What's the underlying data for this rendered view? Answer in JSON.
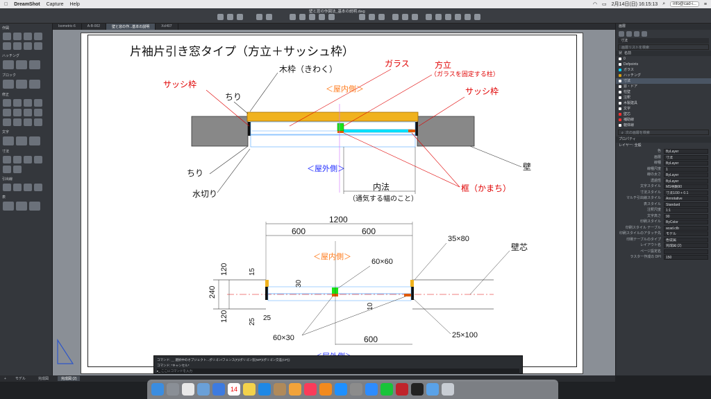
{
  "menubar": {
    "apple": "",
    "app_name": "DreamShot",
    "items": [
      "Capture",
      "Help"
    ],
    "clock": "2月14日(日)  16:15:13",
    "account": "info@cad-i..."
  },
  "window": {
    "title": "壁と窓の作図法_基本の説明.dwg"
  },
  "tabs": [
    "Isometric-6",
    "A-B-002",
    "壁と窓の作...基本の説明",
    "Xcl407"
  ],
  "left_palette": {
    "title": "作図",
    "sections": [
      "ハッチング",
      "ブロック",
      "修正",
      "文字",
      "寸法",
      "引出線",
      "表"
    ]
  },
  "drawing": {
    "title": "片袖片引き窓タイプ（方立＋サッシュ枠）",
    "top": {
      "mokuwaku": "木枠（きわく）",
      "chiri_top": "ちり",
      "sash_waku": "サッシ枠",
      "glass": "ガラス",
      "houdate": "方立",
      "houdate_note": "（ガラスを固定する柱）",
      "sash_waku_right": "サッシ枠",
      "indoor": "＜屋内側＞",
      "outdoor": "＜屋外側＞",
      "chiri_bottom": "ちり",
      "mizukiri": "水切り",
      "kabe": "壁",
      "uchinori": "内法",
      "uchinori_note": "（通気する幅のこと）",
      "kamachi": "框（かまち）"
    },
    "bottom": {
      "dim_1200": "1200",
      "dim_600_left": "600",
      "dim_600_right": "600",
      "indoor": "＜屋内側＞",
      "outdoor": "＜屋外側＞",
      "dim_35x80": "35×80",
      "kabeshin": "壁芯",
      "dim_60x60": "60×60",
      "dim_120_top": "120",
      "dim_240": "240",
      "dim_120_bottom": "120",
      "dim_15": "15",
      "dim_30": "30",
      "dim_10": "10",
      "dim_25a": "25",
      "dim_25b": "25",
      "dim_60x30": "60×30",
      "dim_600_bottom": "600",
      "dim_25x100": "25×100"
    }
  },
  "command": {
    "line1": "コマンド: ＿ 選択中のオブジェクト...ポリゴン/フェンス(F)/ポリゴン窓(WP)/ポリゴン交差(CP)]:",
    "line2": "コマンド: *キャンセル*",
    "prompt": "ここにコマンドを入力"
  },
  "right_palette": {
    "layers_title": "画層",
    "layer_current": "寸法",
    "layer_filter": "画層リストを検索",
    "layers_header": [
      "状",
      "名前"
    ],
    "layers": [
      {
        "name": "0",
        "color": "#ffffff"
      },
      {
        "name": "Defpoints",
        "color": "#ffffff"
      },
      {
        "name": "ガラス",
        "color": "#00d0ff"
      },
      {
        "name": "ハッチング",
        "color": "#d4a017"
      },
      {
        "name": "寸法",
        "color": "#ffffff"
      },
      {
        "name": "窓・ドア",
        "color": "#ffffff"
      },
      {
        "name": "柱壁",
        "color": "#ffffff"
      },
      {
        "name": "注釈",
        "color": "#ffffff"
      },
      {
        "name": "木製建具",
        "color": "#ffffff"
      },
      {
        "name": "文字",
        "color": "#ffffff"
      },
      {
        "name": "壁芯",
        "color": "#ff3030"
      },
      {
        "name": "補助線",
        "color": "#ff3030"
      },
      {
        "name": "躯体線",
        "color": "#ffffff"
      }
    ],
    "layer_search": "次の画層を検索",
    "props_title": "プロパティ",
    "props_header": "レイヤー: 全般",
    "props": [
      {
        "label": "色",
        "value": "ByLayer"
      },
      {
        "label": "画層",
        "value": "寸法"
      },
      {
        "label": "線種",
        "value": "ByLayer"
      },
      {
        "label": "線種尺度",
        "value": "1"
      },
      {
        "label": "線の太さ",
        "value": "ByLayer"
      },
      {
        "label": "透過性",
        "value": "ByLayer"
      },
      {
        "label": "文字スタイル",
        "value": "MS明朝90"
      },
      {
        "label": "寸法スタイル",
        "value": "寸法1/30 + 0.1"
      },
      {
        "label": "マルチ引出線スタイル",
        "value": "Annotative"
      },
      {
        "label": "表スタイル",
        "value": "Standard"
      },
      {
        "label": "注釈尺度",
        "value": "1:1"
      },
      {
        "label": "文字高さ",
        "value": "90"
      },
      {
        "label": "印刷スタイル",
        "value": "ByColor"
      },
      {
        "label": "印刷スタイル テーブル",
        "value": "acad.ctb"
      },
      {
        "label": "印刷スタイルのアタッチ先",
        "value": "モデル"
      },
      {
        "label": "印刷テーブルのタイプ",
        "value": "色従属"
      },
      {
        "label": "レイアウト名",
        "value": "完成図 (2)"
      },
      {
        "label": "ページ設定名",
        "value": ""
      },
      {
        "label": "ラスター作成の DPI",
        "value": "150"
      }
    ]
  },
  "status": {
    "tabs": [
      "モデル",
      "完成図",
      "完成図 (2)"
    ],
    "active": "完成図 (2)"
  },
  "dock": {
    "apps": [
      "Finder",
      "Launchpad",
      "Chrome",
      "Preview",
      "Mail",
      "Calendar",
      "Notes",
      "Safari",
      "Contacts",
      "Photos",
      "Music",
      "Books",
      "App Store",
      "System Preferences",
      "Zoom",
      "LINE",
      "AutoCAD",
      "Terminal",
      "Downloads",
      "Trash"
    ],
    "calendar_day": "14"
  }
}
